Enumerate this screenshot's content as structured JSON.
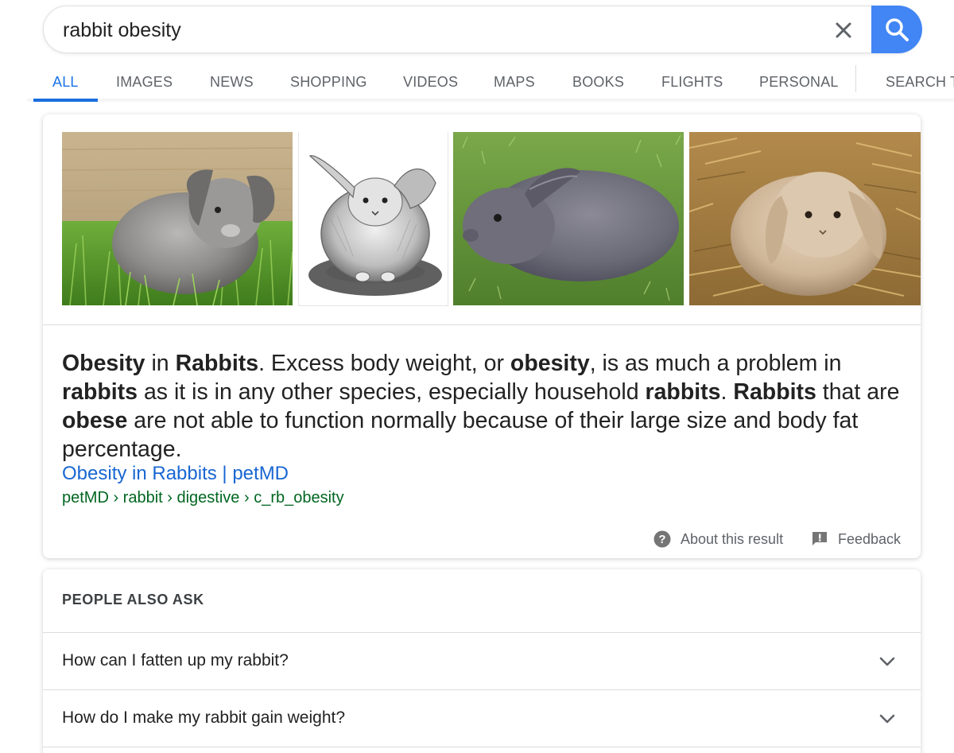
{
  "search": {
    "query": "rabbit obesity",
    "clear_icon": "close-icon",
    "search_icon": "magnifier-icon",
    "accent_color": "#4285f4"
  },
  "tabs": [
    {
      "label": "ALL",
      "active": true
    },
    {
      "label": "IMAGES"
    },
    {
      "label": "NEWS"
    },
    {
      "label": "SHOPPING"
    },
    {
      "label": "VIDEOS"
    },
    {
      "label": "MAPS"
    },
    {
      "label": "BOOKS"
    },
    {
      "label": "FLIGHTS"
    },
    {
      "label": "PERSONAL"
    },
    {
      "label": "SEARCH TOOLS",
      "truncated": true
    }
  ],
  "featured_snippet": {
    "images": [
      {
        "subject": "grey lop rabbit on grass"
      },
      {
        "subject": "pencil drawing of rabbit"
      },
      {
        "subject": "grey rabbit lying on grass"
      },
      {
        "subject": "beige lop rabbit on straw"
      }
    ],
    "text": {
      "s1": "Obesity",
      "s2": " in ",
      "s3": "Rabbits",
      "s4": ". Excess body weight, or ",
      "s5": "obesity",
      "s6": ", is as much a problem in ",
      "s7": "rabbits",
      "s8": " as it is in any other species, especially household ",
      "s9": "rabbits",
      "s10": ". ",
      "s11": "Rabbits",
      "s12": " that are ",
      "s13": "obese",
      "s14": " are not able to function normally because of their large size and body fat percentage."
    },
    "title": "Obesity in Rabbits | petMD",
    "url": "petMD › rabbit › digestive › c_rb_obesity",
    "about_label": "About this result",
    "about_icon": "help-circle-icon",
    "feedback_label": "Feedback",
    "feedback_icon": "feedback-icon"
  },
  "people_also_ask": {
    "heading": "PEOPLE ALSO ASK",
    "questions": [
      "How can I fatten up my rabbit?",
      "How do I make my rabbit gain weight?"
    ],
    "chevron_icon": "chevron-down-icon"
  },
  "colors": {
    "link": "#1967d2",
    "url": "#006621",
    "active_tab": "#1a73e8"
  }
}
